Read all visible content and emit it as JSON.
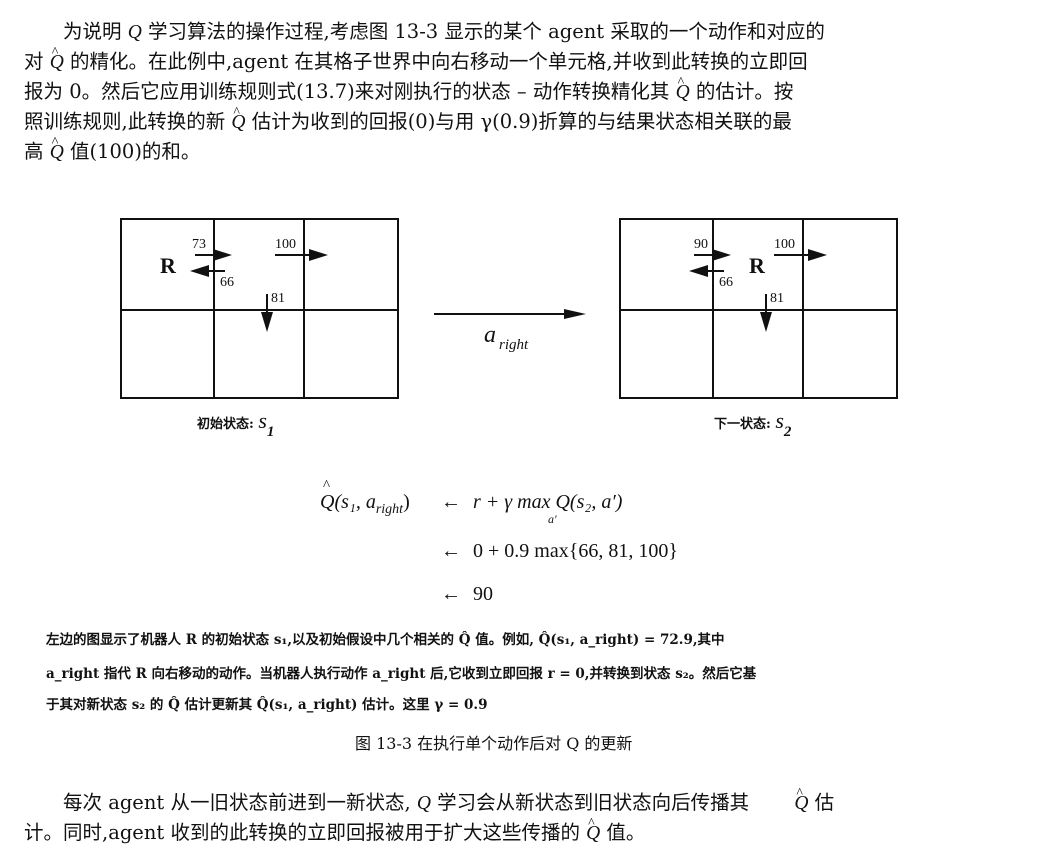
{
  "para1": {
    "line1_a": "为说明 ",
    "line1_q": "Q",
    "line1_b": " 学习算法的操作过程,考虑图 13-3 显示的某个 agent 采取的一个动作和对应的",
    "line2_a": "对 ",
    "line2_q": "Q",
    "line2_b": " 的精化。在此例中,agent 在其格子世界中向右移动一个单元格,并收到此转换的立即回",
    "line3_a": "报为 0。然后它应用训练规则式(13.7)来对刚执行的状态 – 动作转换精化其 ",
    "line3_q": "Q",
    "line3_b": " 的估计。按",
    "line4_a": "照训练规则,此转换的新 ",
    "line4_q": "Q",
    "line4_b": " 估计为收到的回报(0)与用 γ(0.9)折算的与结果状态相关联的最",
    "line5_a": "高 ",
    "line5_q": "Q",
    "line5_b": " 值(100)的和。"
  },
  "figure": {
    "left_grid": {
      "robot": "R",
      "val_top_arrow": "73",
      "val_left_arrow": "66",
      "val_right_arrow": "100",
      "val_down_arrow": "81"
    },
    "right_grid": {
      "robot": "R",
      "val_top_arrow": "90",
      "val_left_arrow": "66",
      "val_right_arrow": "100",
      "val_down_arrow": "81"
    },
    "action_a": "a",
    "action_sub": "right",
    "left_caption": "初始状态:",
    "left_state": "s",
    "left_state_sub": "1",
    "right_caption": "下一状态:",
    "right_state": "s",
    "right_state_sub": "2"
  },
  "equation": {
    "lhs": "Q(s₁, a",
    "lhs_sub": "right",
    "lhs_close": ")",
    "arrow": "←",
    "rhs1": "r + γ max Q(s₂, a′)",
    "max_sub": "a′",
    "rhs2": "0 + 0.9  max{66, 81, 100}",
    "rhs3": "90"
  },
  "caption": {
    "line1": "左边的图显示了机器人 R 的初始状态 s₁,以及初始假设中几个相关的 Q̂ 值。例如, Q̂(s₁, a_right) = 72.9,其中",
    "line2": "a_right 指代 R 向右移动的动作。当机器人执行动作 a_right 后,它收到立即回报 r = 0,并转换到状态 s₂。然后它基",
    "line3": "于其对新状态 s₂ 的 Q̂ 估计更新其 Q̂(s₁, a_right) 估计。这里 γ = 0.9",
    "title": "图 13-3   在执行单个动作后对 Q 的更新"
  },
  "para2": {
    "line1_a": "每次 agent 从一旧状态前进到一新状态, ",
    "line1_q": "Q",
    "line1_b": " 学习会从新状态到旧状态向后传播其 ",
    "line1_q2": "Q",
    "line1_c": " 估",
    "line2_a": "计。同时,agent 收到的此转换的立即回报被用于扩大这些传播的 ",
    "line2_q": "Q",
    "line2_b": " 值。"
  }
}
